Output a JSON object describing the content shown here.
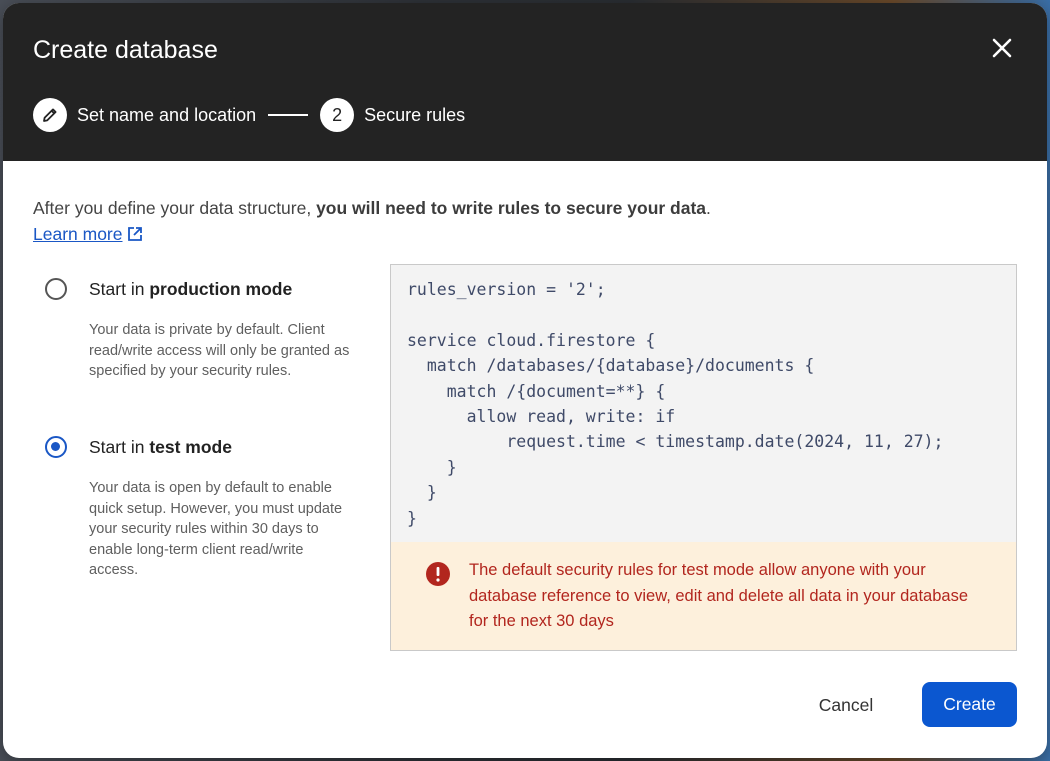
{
  "dialog": {
    "title": "Create database",
    "close_icon": "close-icon"
  },
  "stepper": {
    "steps": [
      {
        "label": "Set name and location",
        "marker": "",
        "icon": "pencil-icon",
        "state": "completed"
      },
      {
        "label": "Secure rules",
        "marker": "2",
        "state": "active"
      }
    ]
  },
  "intro": {
    "text_plain": "After you define your data structure, ",
    "text_bold": "you will need to write rules to secure your data",
    "text_end": ".",
    "learn_more": "Learn more",
    "learn_more_icon": "external-link-icon"
  },
  "modes": [
    {
      "label_prefix": "Start in ",
      "label_bold": "production mode",
      "description": "Your data is private by default. Client read/write access will only be granted as specified by your security rules.",
      "selected": false
    },
    {
      "label_prefix": "Start in ",
      "label_bold": "test mode",
      "description": "Your data is open by default to enable quick setup. However, you must update your security rules within 30 days to enable long-term client read/write access.",
      "selected": true
    }
  ],
  "rules_code": "rules_version = '2';\n\nservice cloud.firestore {\n  match /databases/{database}/documents {\n    match /{document=**} {\n      allow read, write: if\n          request.time < timestamp.date(2024, 11, 27);\n    }\n  }\n}",
  "warning": {
    "icon": "error-icon",
    "text": "The default security rules for test mode allow anyone with your database reference to view, edit and delete all data in your database for the next 30 days"
  },
  "actions": {
    "cancel_label": "Cancel",
    "create_label": "Create"
  },
  "colors": {
    "header_bg": "#232323",
    "primary": "#0b57d0",
    "link": "#1a57c5",
    "warning_bg": "#fdf0dc",
    "warning_text": "#b2261e"
  }
}
